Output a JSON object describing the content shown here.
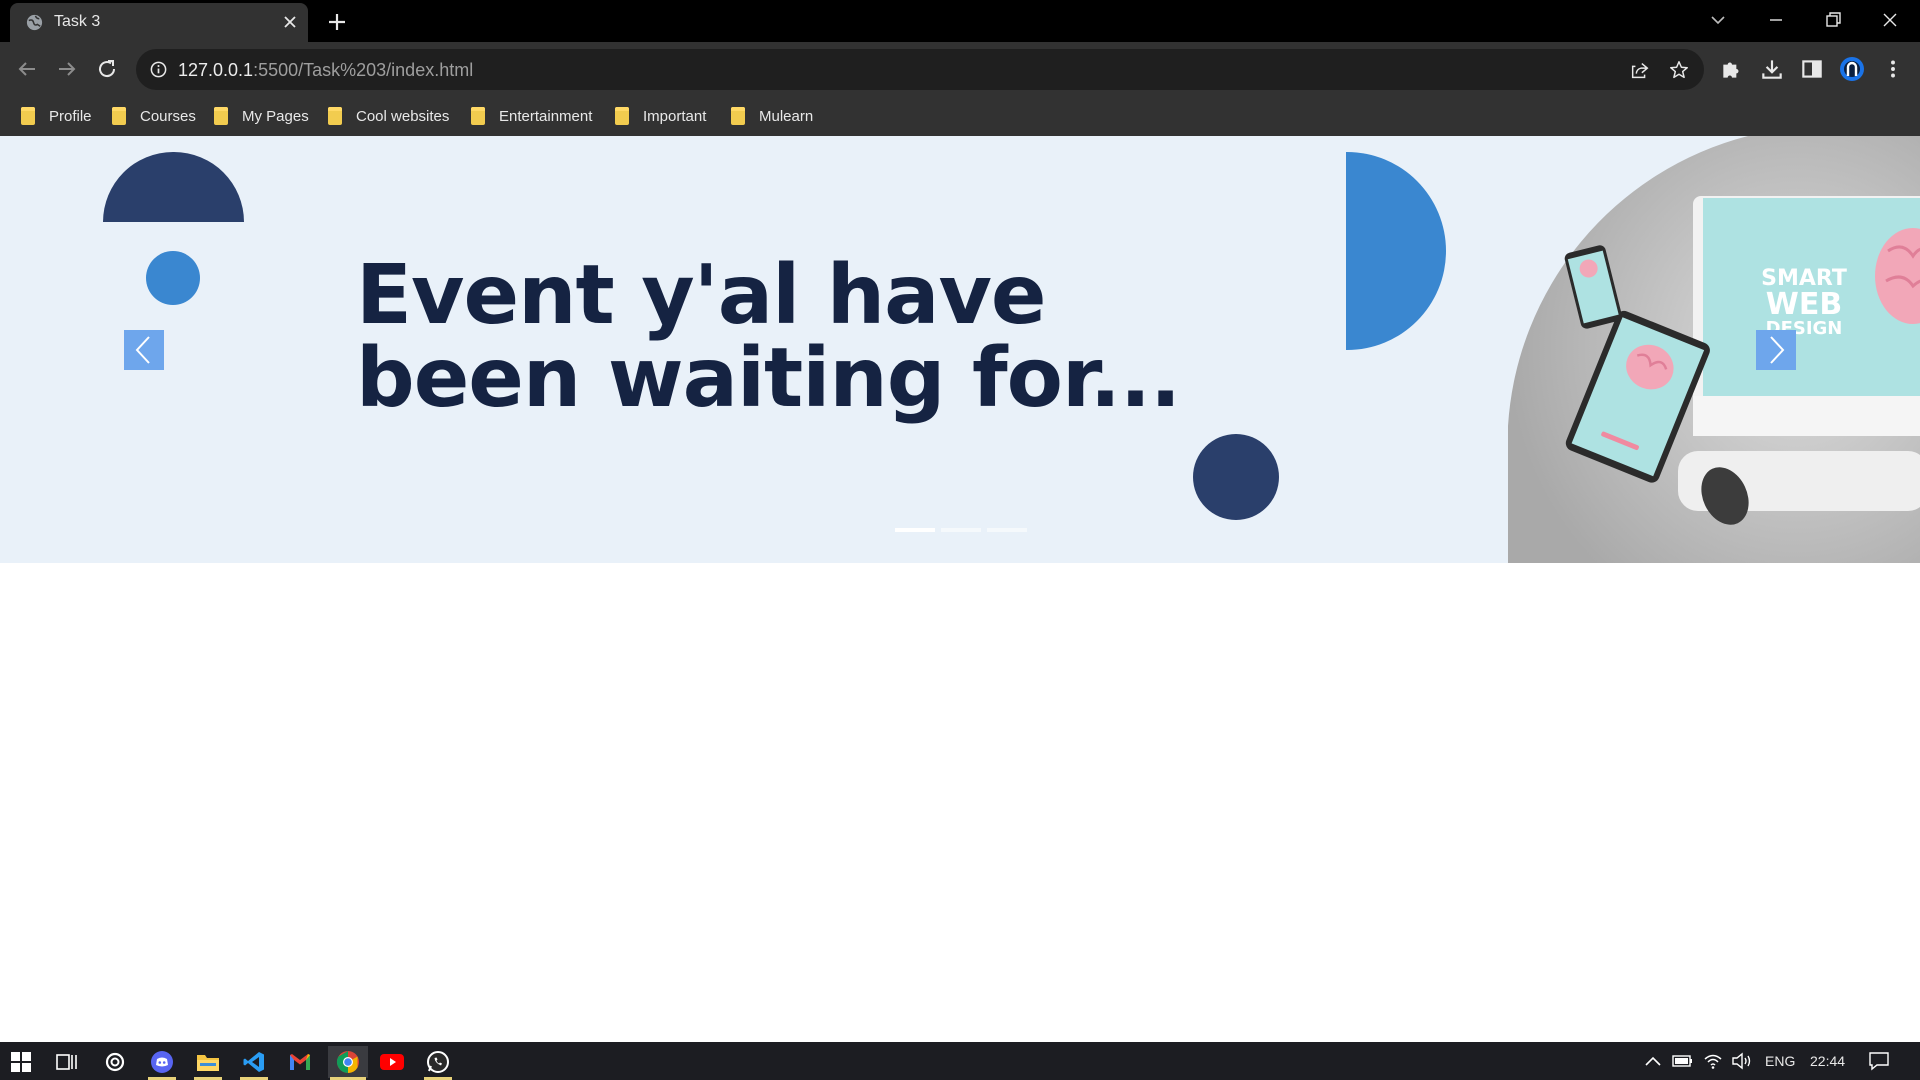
{
  "browser": {
    "tab": {
      "title": "Task 3"
    },
    "address": {
      "host": "127.0.0.1",
      "rest": ":5500/Task%203/index.html"
    },
    "bookmarks": [
      "Profile",
      "Courses",
      "My Pages",
      "Cool websites",
      "Entertainment",
      "Important",
      "Mulearn"
    ]
  },
  "page": {
    "headline_line1": "Event y'al have",
    "headline_line2": "been waiting for...",
    "hero_image": {
      "line1": "SMART",
      "line2": "WEB",
      "line3": "DESIGN"
    },
    "carousel": {
      "slide_count": 3,
      "active_slide": 1
    },
    "colors": {
      "hero_bg": "#e9f1f9",
      "navy": "#2a3f6b",
      "blue": "#3a87d0",
      "text": "#152342",
      "arrow_bg": "#6ea6ec"
    }
  },
  "taskbar": {
    "language": "ENG",
    "time": "22:44",
    "apps": [
      "windows-start",
      "task-view",
      "cortana",
      "discord",
      "file-explorer",
      "vscode",
      "gmail",
      "chrome",
      "youtube",
      "whatsapp"
    ]
  }
}
